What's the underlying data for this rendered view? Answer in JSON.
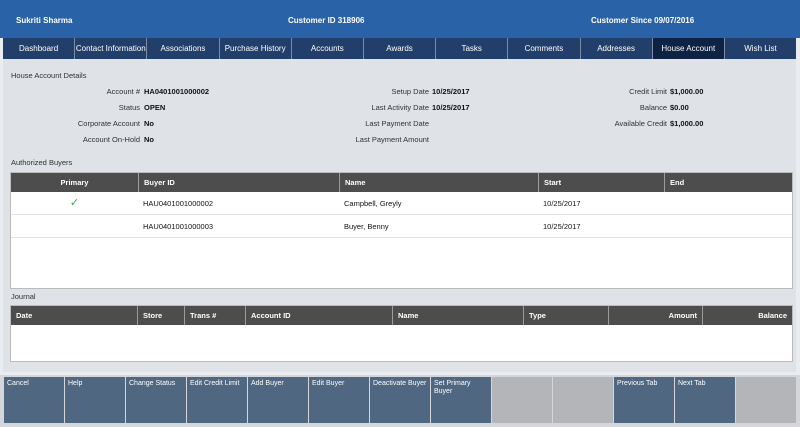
{
  "header": {
    "customer_name": "Sukriti Sharma",
    "customer_id": "Customer ID  318906",
    "customer_since": "Customer Since  09/07/2016"
  },
  "tabs": [
    {
      "label": "Dashboard",
      "active": false
    },
    {
      "label": "Contact Information",
      "active": false
    },
    {
      "label": "Associations",
      "active": false
    },
    {
      "label": "Purchase History",
      "active": false
    },
    {
      "label": "Accounts",
      "active": false
    },
    {
      "label": "Awards",
      "active": false
    },
    {
      "label": "Tasks",
      "active": false
    },
    {
      "label": "Comments",
      "active": false
    },
    {
      "label": "Addresses",
      "active": false
    },
    {
      "label": "House Account",
      "active": true
    },
    {
      "label": "Wish List",
      "active": false
    }
  ],
  "details": {
    "title": "House Account Details",
    "account_label": "Account #",
    "account_value": "HA0401001000002",
    "status_label": "Status",
    "status_value": "OPEN",
    "corporate_label": "Corporate Account",
    "corporate_value": "No",
    "onhold_label": "Account On-Hold",
    "onhold_value": "No",
    "setup_label": "Setup Date",
    "setup_value": "10/25/2017",
    "lastact_label": "Last Activity Date",
    "lastact_value": "10/25/2017",
    "lastpay_label": "Last Payment Date",
    "lastpay_value": "",
    "lastamt_label": "Last Payment Amount",
    "lastamt_value": "",
    "credit_label": "Credit Limit",
    "credit_value": "$1,000.00",
    "balance_label": "Balance",
    "balance_value": "$0.00",
    "avail_label": "Available Credit",
    "avail_value": "$1,000.00"
  },
  "buyers": {
    "title": "Authorized Buyers",
    "columns": [
      "Primary",
      "Buyer ID",
      "Name",
      "Start",
      "End"
    ],
    "rows": [
      {
        "primary_icon": "checkmark-icon",
        "primary_glyph": "✓",
        "buyer_id": "HAU0401001000002",
        "name": "Campbell, Greyly",
        "start": "10/25/2017",
        "end": ""
      },
      {
        "primary_icon": "",
        "primary_glyph": "",
        "buyer_id": "HAU0401001000003",
        "name": "Buyer, Benny",
        "start": "10/25/2017",
        "end": ""
      }
    ]
  },
  "journal": {
    "title": "Journal",
    "columns": [
      "Date",
      "Store",
      "Trans #",
      "Account ID",
      "Name",
      "Type",
      "Amount",
      "Balance"
    ]
  },
  "footer": [
    {
      "label": "Cancel",
      "enabled": true
    },
    {
      "label": "Help",
      "enabled": true
    },
    {
      "label": "Change Status",
      "enabled": true
    },
    {
      "label": "Edit Credit Limit",
      "enabled": true
    },
    {
      "label": "Add Buyer",
      "enabled": true
    },
    {
      "label": "Edit Buyer",
      "enabled": true
    },
    {
      "label": "Deactivate Buyer",
      "enabled": true
    },
    {
      "label": "Set Primary Buyer",
      "enabled": true
    },
    {
      "label": "",
      "enabled": false
    },
    {
      "label": "",
      "enabled": false
    },
    {
      "label": "Previous Tab",
      "enabled": true
    },
    {
      "label": "Next Tab",
      "enabled": true
    },
    {
      "label": "",
      "enabled": false
    }
  ],
  "colors": {
    "header_bg": "#2a62a8",
    "tab_bar_bg": "#223f6b",
    "tab_active_bg": "#0e2244",
    "table_header_bg": "#4d4d4d",
    "footer_button_bg": "#4f6780",
    "footer_button_disabled": "#b3b5b8",
    "check_color": "#32a84a"
  }
}
